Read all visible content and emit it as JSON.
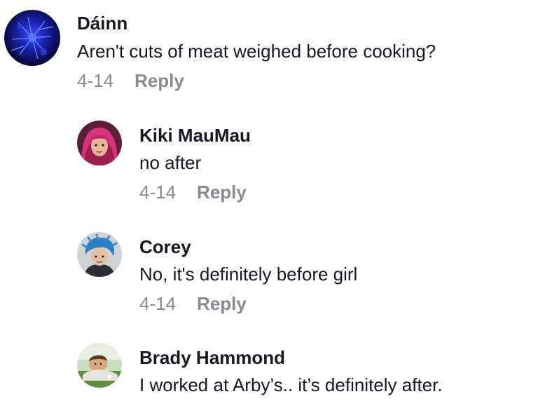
{
  "comments": [
    {
      "username": "Dáinn",
      "text": "Aren't cuts of meat weighed before cooking?",
      "date": "4-14",
      "reply_label": "Reply",
      "avatar": "blue-flower-avatar"
    },
    {
      "username": "Kiki MauMau",
      "text": "no after",
      "date": "4-14",
      "reply_label": "Reply",
      "avatar": "pink-hair-avatar"
    },
    {
      "username": "Corey",
      "text": "No, it's definitely before girl",
      "date": "4-14",
      "reply_label": "Reply",
      "avatar": "blue-hair-avatar"
    },
    {
      "username": "Brady Hammond",
      "text": "I worked at Arby’s.. it’s definitely after.",
      "avatar": "outdoor-photo-avatar"
    }
  ]
}
